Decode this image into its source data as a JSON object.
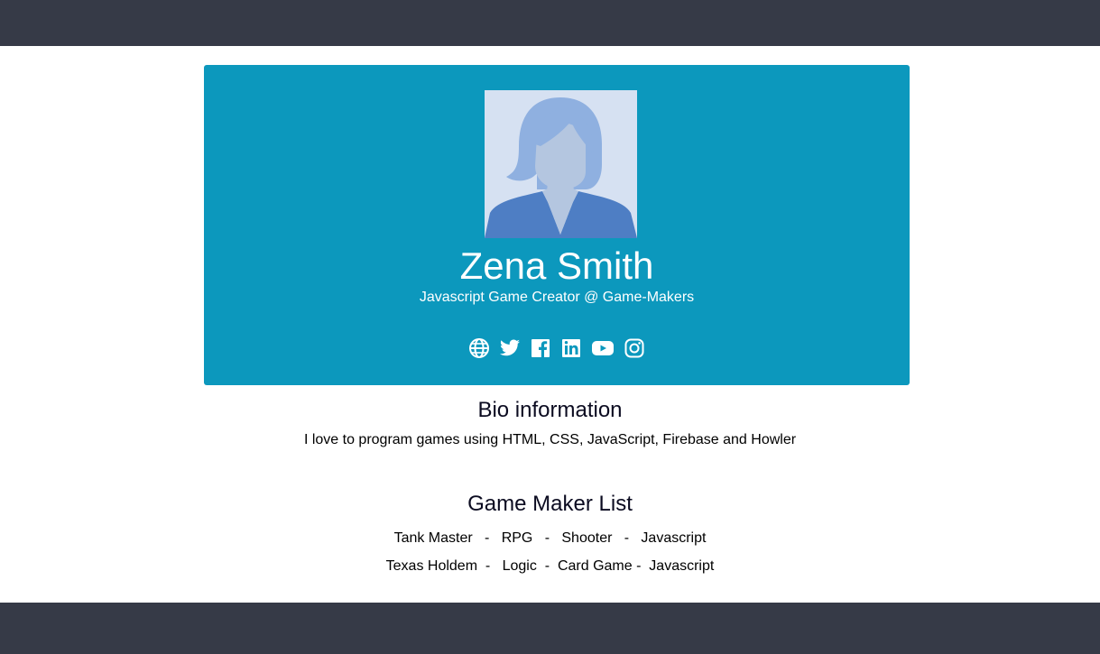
{
  "profile": {
    "name": "Zena Smith",
    "role": "Javascript Game Creator @ Game-Makers"
  },
  "social": {
    "icons": [
      "globe-icon",
      "twitter-icon",
      "facebook-icon",
      "linkedin-icon",
      "youtube-icon",
      "instagram-icon"
    ]
  },
  "bio": {
    "title": "Bio information",
    "text": "I love to program games using HTML, CSS, JavaScript, Firebase and Howler"
  },
  "games": {
    "title": "Game Maker List",
    "rows": [
      "Tank Master   -   RPG   -   Shooter   -   Javascript",
      "Texas Holdem  -   Logic  -  Card Game -  Javascript"
    ]
  },
  "colors": {
    "header_footer": "#363a47",
    "card": "#0c98bd",
    "avatar_bg": "#d6e1f2"
  }
}
